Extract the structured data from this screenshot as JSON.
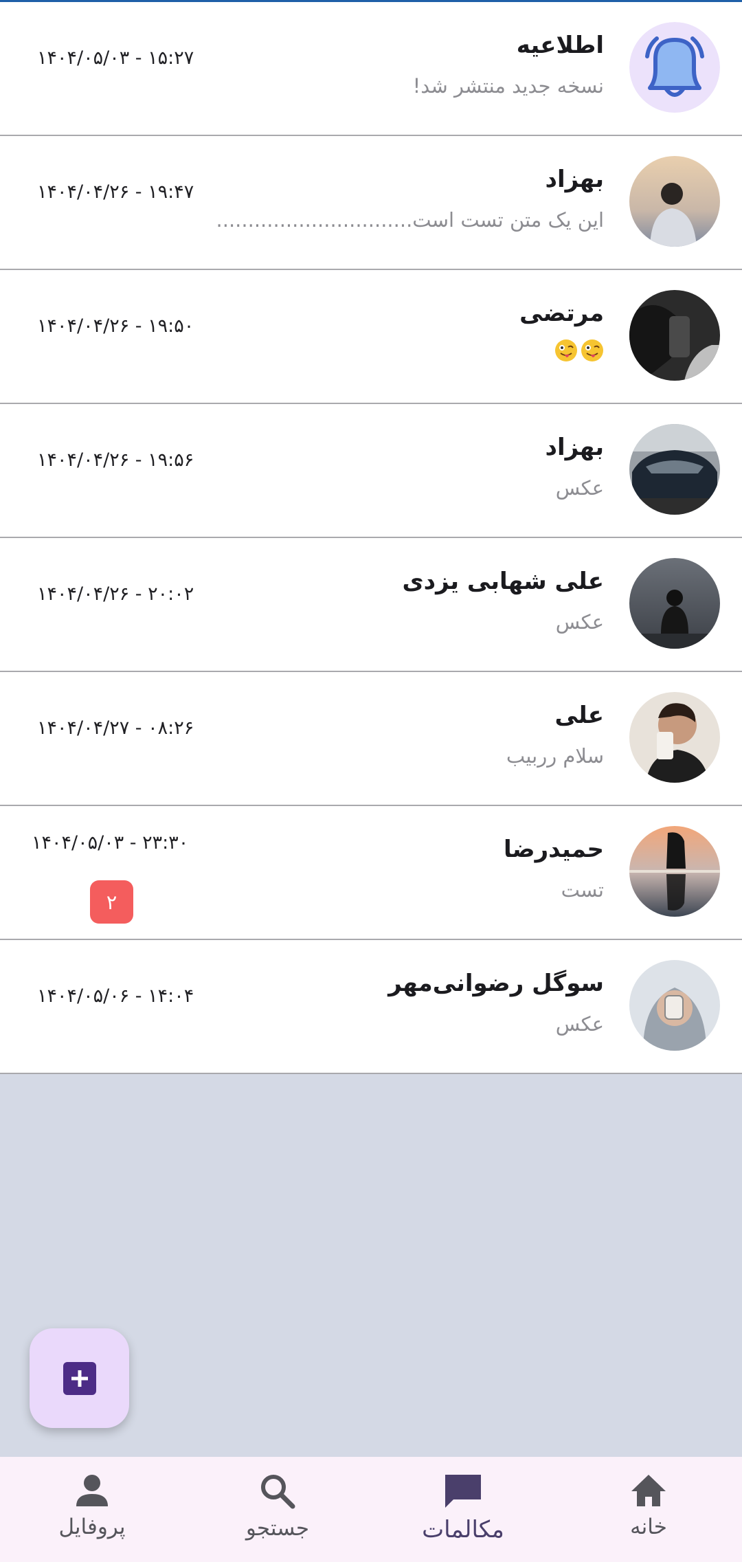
{
  "conversations": [
    {
      "name": "اطلاعیه",
      "preview": "نسخه جدید منتشر شد!",
      "time": "۱۴۰۴/۰۵/۰۳ - ۱۵:۲۷",
      "avatar": "bell-icon"
    },
    {
      "name": "بهزاد",
      "preview": "این یک متن تست است...............................",
      "time": "۱۴۰۴/۰۴/۲۶ - ۱۹:۴۷",
      "avatar": "photo"
    },
    {
      "name": "مرتضی",
      "preview": "",
      "preview_emoji": "winking-face-with-tongue",
      "time": "۱۴۰۴/۰۴/۲۶ - ۱۹:۵۰",
      "avatar": "photo"
    },
    {
      "name": "بهزاد",
      "preview": "عکس",
      "time": "۱۴۰۴/۰۴/۲۶ - ۱۹:۵۶",
      "avatar": "photo"
    },
    {
      "name": "علی شهابی یزدی",
      "preview": "عکس",
      "time": "۱۴۰۴/۰۴/۲۶ - ۲۰:۰۲",
      "avatar": "photo"
    },
    {
      "name": "علی",
      "preview": "سلام رربیب",
      "time": "۱۴۰۴/۰۴/۲۷ - ۰۸:۲۶",
      "avatar": "photo"
    },
    {
      "name": "حمیدرضا",
      "preview": "تست",
      "time": "۱۴۰۴/۰۵/۰۳ - ۲۳:۳۰",
      "unread": "۲",
      "avatar": "photo"
    },
    {
      "name": "سوگل رضوانی‌مهر",
      "preview": "عکس",
      "time": "۱۴۰۴/۰۵/۰۶ - ۱۴:۰۴",
      "avatar": "photo"
    }
  ],
  "fab": {
    "icon": "plus-box-icon"
  },
  "bottom_nav": [
    {
      "label": "خانه",
      "icon": "home-icon"
    },
    {
      "label": "مکالمات",
      "icon": "chat-icon",
      "active": true
    },
    {
      "label": "جستجو",
      "icon": "search-icon"
    },
    {
      "label": "پروفایل",
      "icon": "person-icon"
    }
  ],
  "colors": {
    "accent_top": "#1f5fa8",
    "badge": "#f45d5d",
    "fab_bg": "#ead9fb",
    "fab_icon": "#4c2c86",
    "nav_bg": "#fbf1fa",
    "empty_bg": "#d4d9e5"
  }
}
